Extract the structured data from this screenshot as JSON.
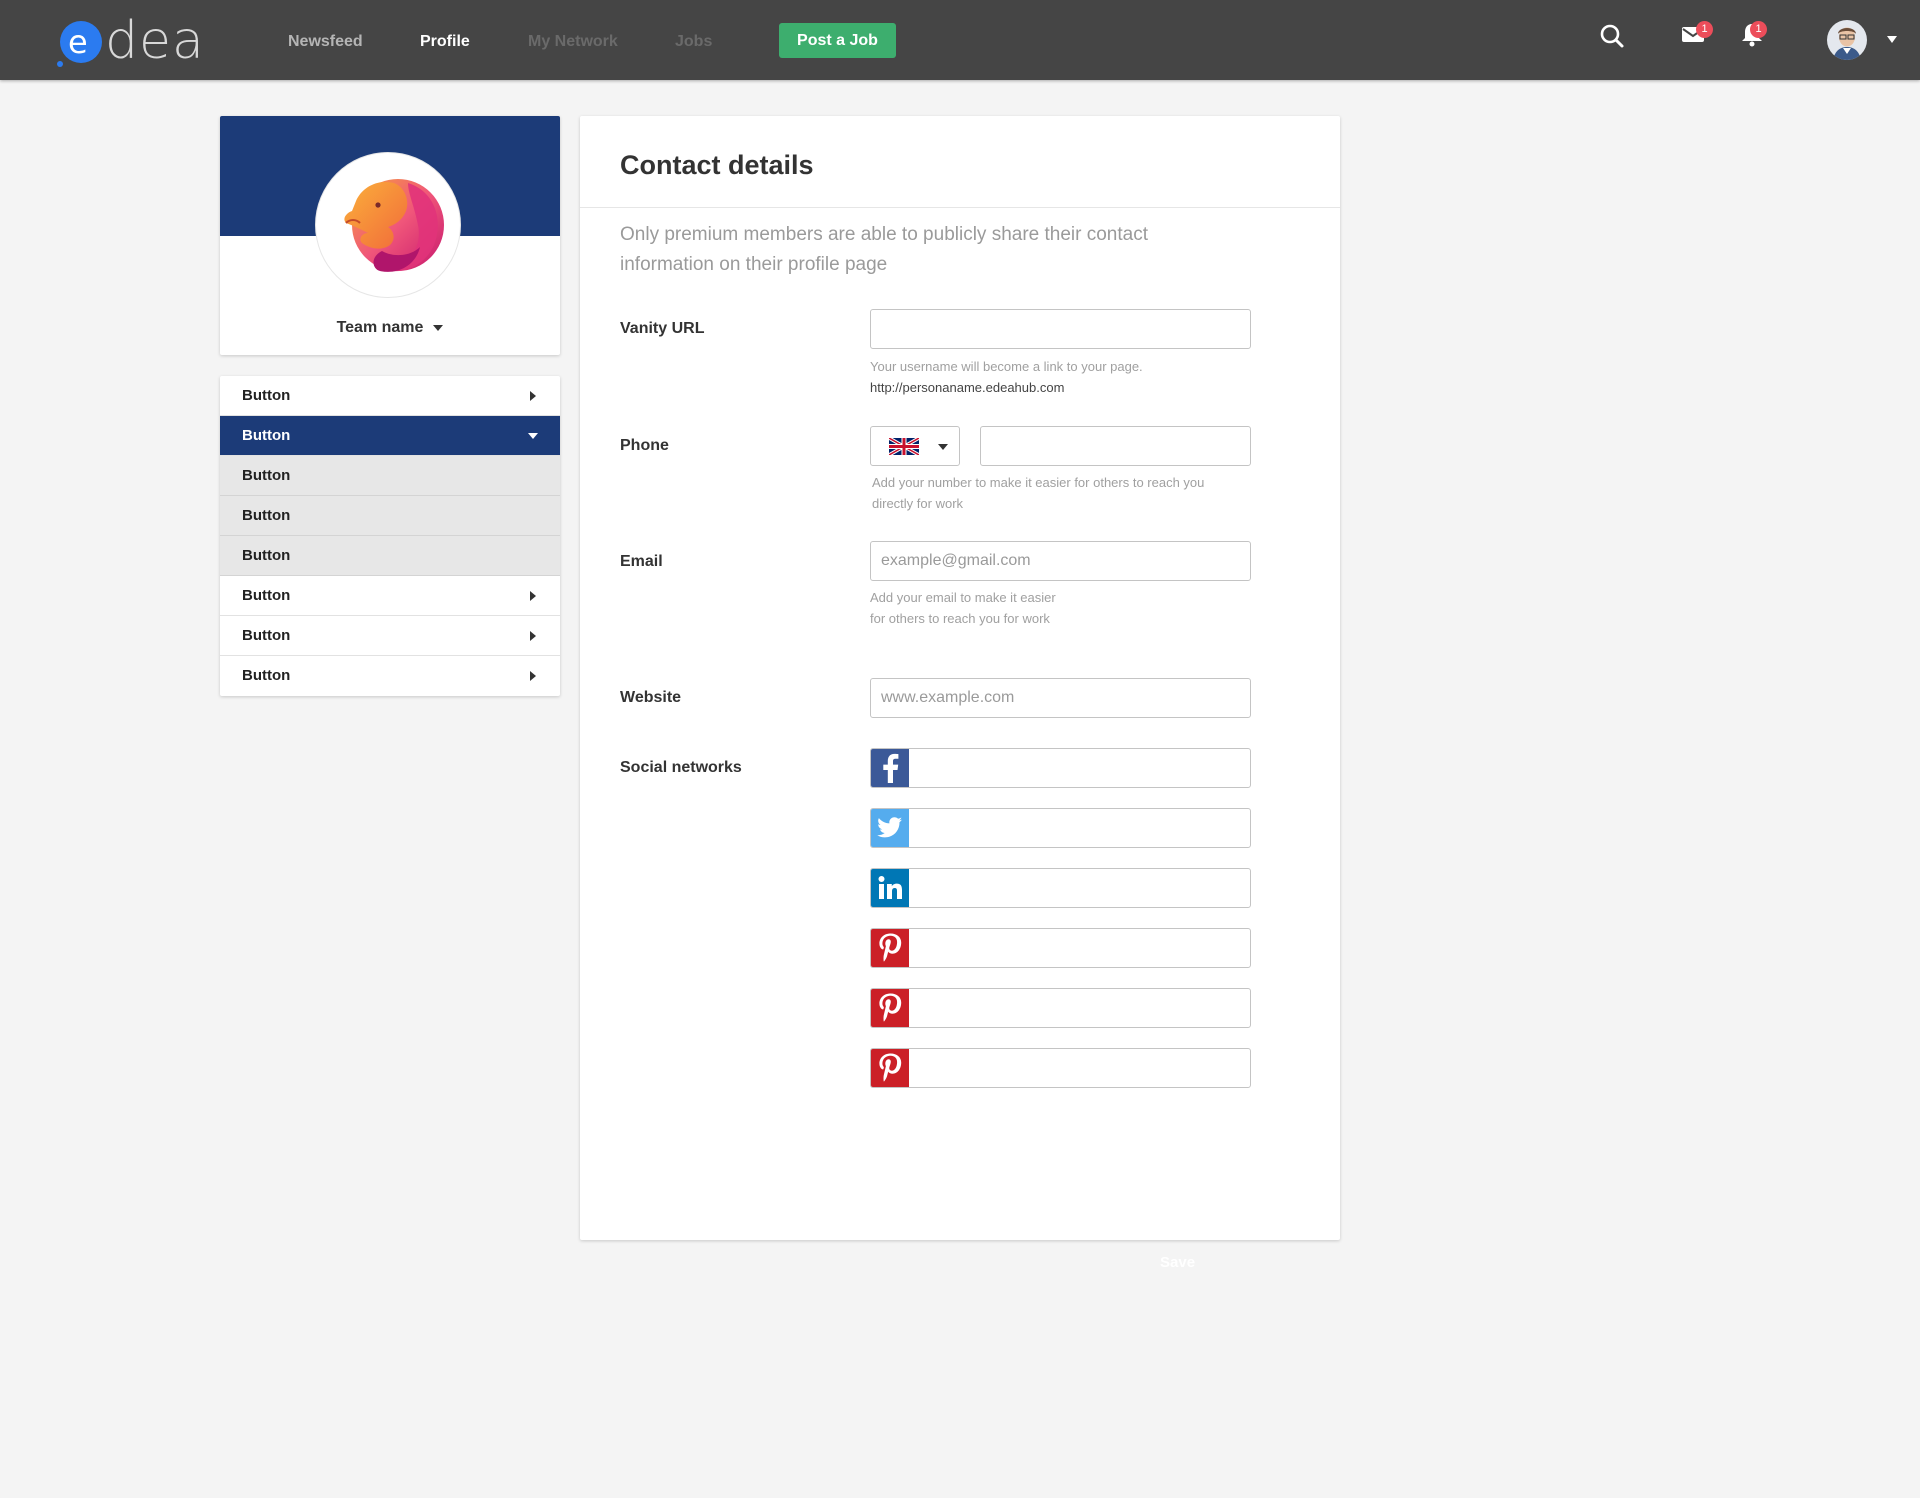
{
  "header": {
    "logo_text": "edea",
    "nav": [
      {
        "label": "Newsfeed",
        "state": "default"
      },
      {
        "label": "Profile",
        "state": "active"
      },
      {
        "label": "My Network",
        "state": "dim"
      },
      {
        "label": "Jobs",
        "state": "dim"
      }
    ],
    "post_job_label": "Post a Job",
    "messages_badge": "1",
    "notifications_badge": "1",
    "colors": {
      "bar": "#454545",
      "post_job": "#3dae6e",
      "badge": "#ec4d5a",
      "logo_accent": "#2b7bf0"
    }
  },
  "sidebar": {
    "team_name": "Team name",
    "banner_color": "#1c3b78",
    "menu": [
      {
        "label": "Button",
        "state": "collapsed"
      },
      {
        "label": "Button",
        "state": "expanded"
      },
      {
        "label": "Button",
        "state": "sub"
      },
      {
        "label": "Button",
        "state": "sub"
      },
      {
        "label": "Button",
        "state": "sub"
      },
      {
        "label": "Button",
        "state": "collapsed"
      },
      {
        "label": "Button",
        "state": "collapsed"
      },
      {
        "label": "Button",
        "state": "collapsed"
      }
    ]
  },
  "contact": {
    "title": "Contact details",
    "intro": "Only premium members are able to publicly share their contact information on their profile page",
    "vanity": {
      "label": "Vanity URL",
      "value": "",
      "hint": "Your username will become a link to your page.",
      "example_url": "http://personaname.edeahub.com"
    },
    "phone": {
      "label": "Phone",
      "country_flag": "uk-flag-icon",
      "value": "",
      "hint_line1": "Add your number to make it easier for others to reach you",
      "hint_line2": "directly for work"
    },
    "email": {
      "label": "Email",
      "placeholder": "example@gmail.com",
      "hint_line1": "Add your email to make it easier",
      "hint_line2": "for others to reach you for work"
    },
    "website": {
      "label": "Website",
      "placeholder": "www.example.com"
    },
    "social": {
      "label": "Social networks",
      "networks": [
        {
          "icon": "facebook-icon",
          "color": "#3b5998",
          "value": ""
        },
        {
          "icon": "twitter-icon",
          "color": "#55acee",
          "value": ""
        },
        {
          "icon": "linkedin-icon",
          "color": "#0077b5",
          "value": ""
        },
        {
          "icon": "pinterest-icon",
          "color": "#cb2027",
          "value": ""
        },
        {
          "icon": "pinterest-icon",
          "color": "#cb2027",
          "value": ""
        },
        {
          "icon": "pinterest-icon",
          "color": "#cb2027",
          "value": ""
        }
      ]
    },
    "save_label": "Save"
  }
}
